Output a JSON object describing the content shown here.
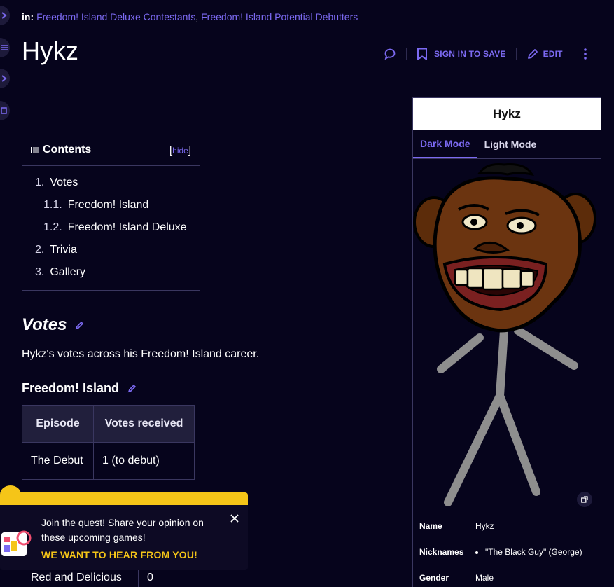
{
  "categories": {
    "prefix": "in:",
    "links": [
      "Freedom! Island Deluxe Contestants",
      "Freedom! Island Potential Debutters"
    ]
  },
  "page": {
    "title": "Hykz"
  },
  "actions": {
    "comment_icon": "speech-bubble-icon",
    "save_label": "SIGN IN TO SAVE",
    "edit_label": "EDIT",
    "more_icon": "kebab-icon"
  },
  "toc": {
    "title": "Contents",
    "hide_label": "hide",
    "items": [
      {
        "num": "1.",
        "label": "Votes"
      },
      {
        "num": "1.1.",
        "label": "Freedom! Island"
      },
      {
        "num": "1.2.",
        "label": "Freedom! Island Deluxe"
      },
      {
        "num": "2.",
        "label": "Trivia"
      },
      {
        "num": "3.",
        "label": "Gallery"
      }
    ]
  },
  "votes": {
    "heading": "Votes",
    "lead": "Hykz's votes across his Freedom! Island career.",
    "sub1": {
      "heading": "Freedom! Island",
      "headers": [
        "Episode",
        "Votes received"
      ],
      "rows": [
        [
          "The Debut",
          "1 (to debut)"
        ]
      ]
    },
    "sub2_partial_row": [
      "Red and Delicious",
      "0"
    ]
  },
  "infobox": {
    "title": "Hykz",
    "tabs": [
      "Dark Mode",
      "Light Mode"
    ],
    "active_tab": "Dark Mode",
    "rows": [
      {
        "label": "Name",
        "value": "Hykz"
      },
      {
        "label": "Nicknames",
        "value": "\"The Black Guy\" (George)"
      },
      {
        "label": "Gender",
        "value": "Male"
      }
    ]
  },
  "toast": {
    "message": "Join the quest! Share your opinion on these upcoming games!",
    "cta": "WE WANT TO HEAR FROM YOU!"
  },
  "colors": {
    "background": "#06041c",
    "accent": "#7c6af2",
    "toast": "#f5c518"
  }
}
